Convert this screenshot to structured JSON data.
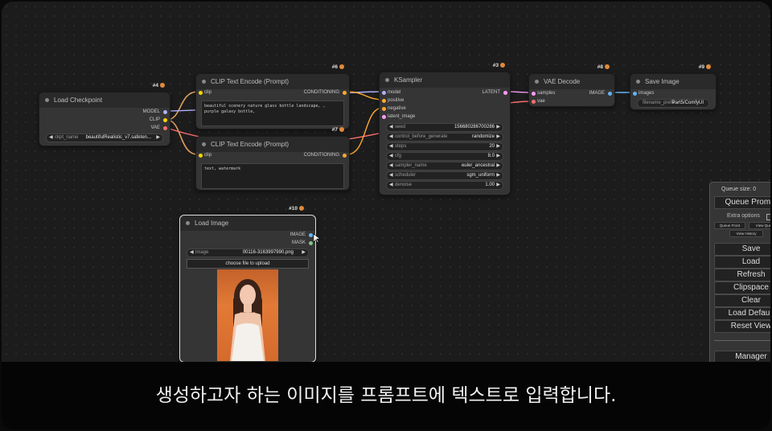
{
  "nodes": {
    "load_checkpoint": {
      "id": "#4",
      "title": "Load Checkpoint",
      "outputs": [
        "MODEL",
        "CLIP",
        "VAE"
      ],
      "widget_label": "ckpt_name",
      "widget_value": "beautifulRealistic_v7.safeten..."
    },
    "clip_pos": {
      "id": "#6",
      "title": "CLIP Text Encode (Prompt)",
      "input": "clip",
      "output": "CONDITIONING",
      "text": "beautiful scenery nature glass bottle landscape, , purple galaxy bottle,"
    },
    "clip_neg": {
      "id": "#7",
      "title": "CLIP Text Encode (Prompt)",
      "input": "clip",
      "output": "CONDITIONING",
      "text": "text, watermark"
    },
    "ksampler": {
      "id": "#3",
      "title": "KSampler",
      "inputs": [
        "model",
        "positive",
        "negative",
        "latent_image"
      ],
      "output": "LATENT",
      "widgets": [
        {
          "label": "seed",
          "value": "156680286700286"
        },
        {
          "label": "control_before_generate",
          "value": "randomize"
        },
        {
          "label": "steps",
          "value": "20"
        },
        {
          "label": "cfg",
          "value": "8.0"
        },
        {
          "label": "sampler_name",
          "value": "euler_ancestral"
        },
        {
          "label": "scheduler",
          "value": "sgm_uniform"
        },
        {
          "label": "denoise",
          "value": "1.00"
        }
      ]
    },
    "vae_decode": {
      "id": "#8",
      "title": "VAE Decode",
      "inputs": [
        "samples",
        "vae"
      ],
      "output": "IMAGE"
    },
    "save_image": {
      "id": "#9",
      "title": "Save Image",
      "input": "images",
      "widget_label": "filename_prefix",
      "widget_value": "Part5/ComfyUI"
    },
    "load_image": {
      "id": "#10",
      "title": "Load Image",
      "outputs": [
        "IMAGE",
        "MASK"
      ],
      "widget_label": "image",
      "widget_value": "00116-3163997990.png",
      "upload_label": "choose file to upload"
    }
  },
  "queue_panel": {
    "size_label": "Queue size: 0",
    "queue_prompt": "Queue Prompt",
    "extra_options": "Extra options",
    "queue_front": "Queue Front",
    "view_queue": "View Queue",
    "view_history": "View History",
    "save": "Save",
    "load": "Load",
    "refresh": "Refresh",
    "clipspace": "Clipspace",
    "clear": "Clear",
    "load_default": "Load Default",
    "reset_view": "Reset View",
    "manager": "Manager"
  },
  "colors": {
    "clip_link": "#e0a060",
    "model_link": "#b0b0ff",
    "latent_link": "#ff9cf9",
    "vae_link": "#ff6e6e",
    "image_link": "#64b5f6",
    "cond_link": "#ffa931",
    "background": "#1c1c1c"
  },
  "subtitle": "생성하고자 하는 이미지를 프롬프트에 텍스트로 입력합니다."
}
